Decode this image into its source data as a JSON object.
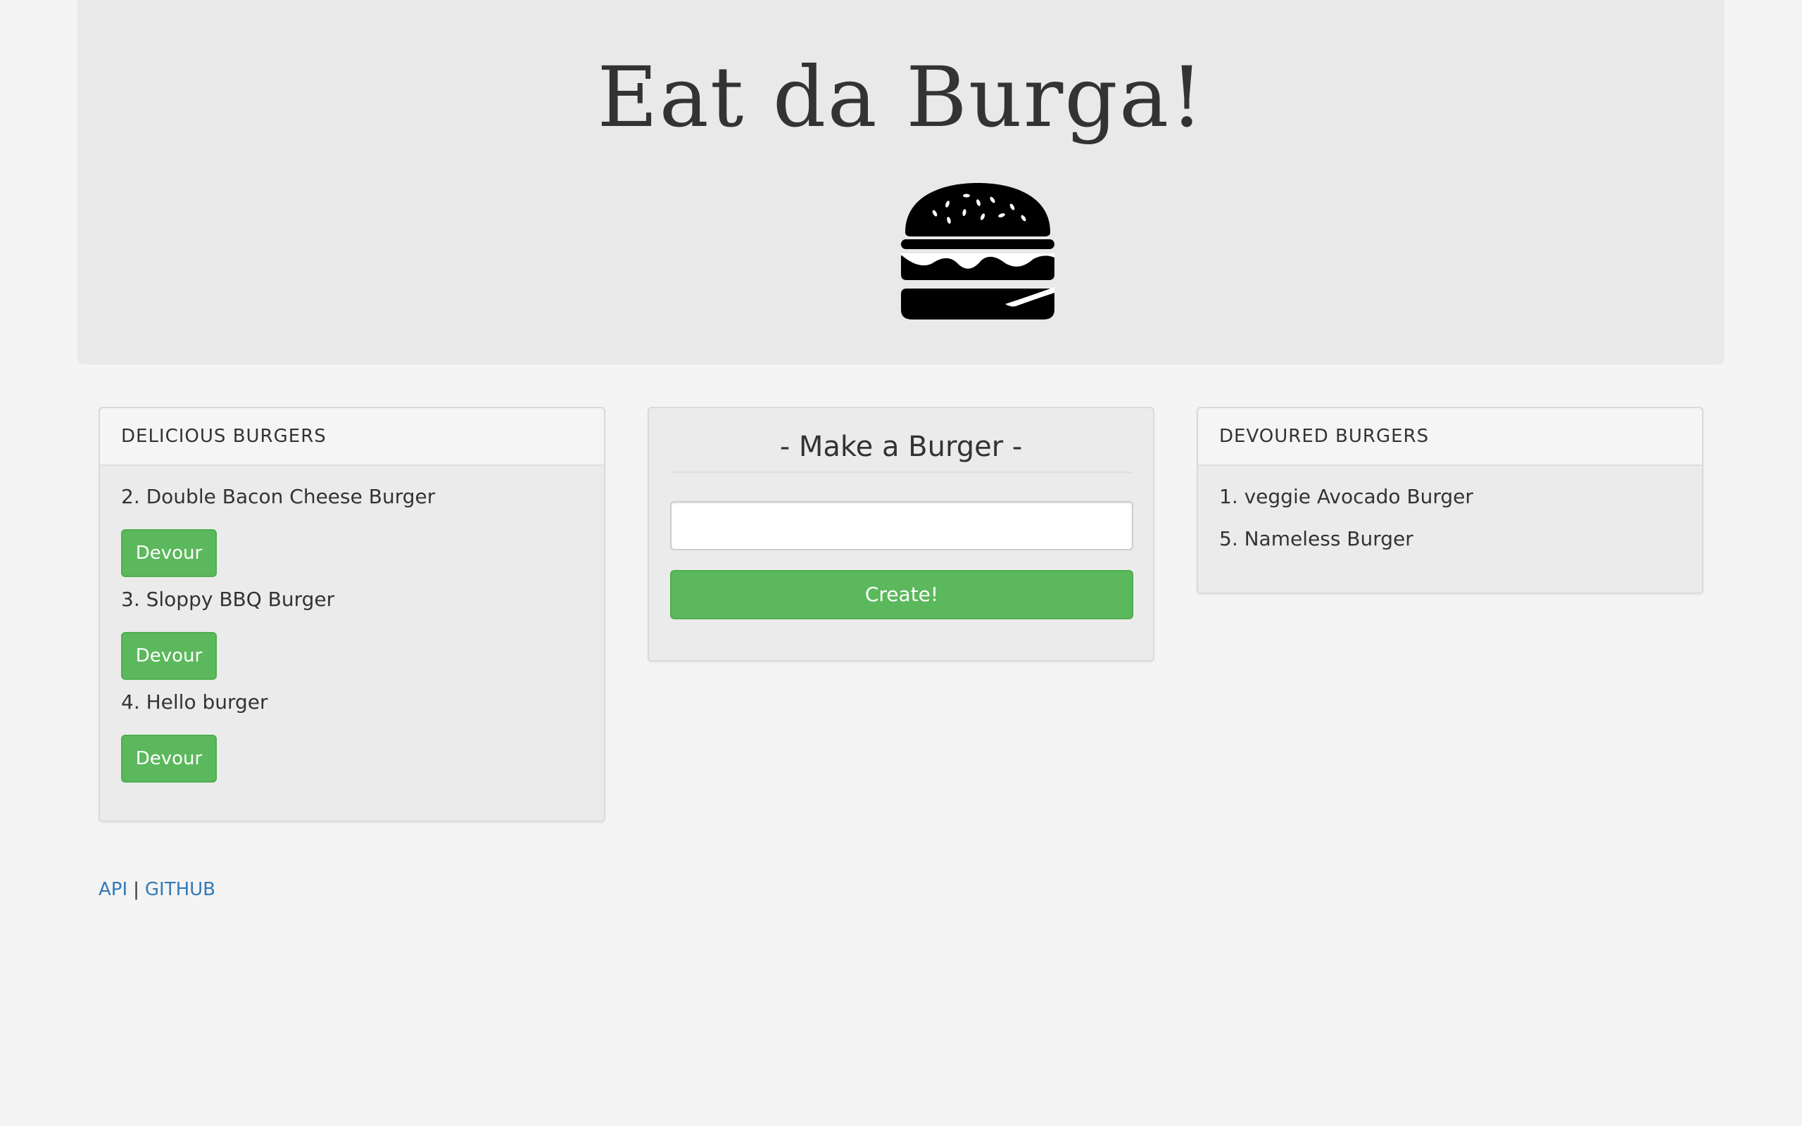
{
  "header": {
    "title": "Eat da Burga!"
  },
  "icons": {
    "hero": "hamburger-icon"
  },
  "colors": {
    "accent_green": "#5cb85c",
    "link_blue": "#337ab7",
    "jumbotron_bg": "#e9e9e9",
    "page_bg": "#f4f4f4"
  },
  "delicious": {
    "heading": "DELICIOUS BURGERS",
    "items": [
      {
        "label": "2. Double Bacon Cheese Burger",
        "button": "Devour"
      },
      {
        "label": "3. Sloppy BBQ Burger",
        "button": "Devour"
      },
      {
        "label": "4. Hello burger",
        "button": "Devour"
      }
    ]
  },
  "make": {
    "title": "- Make a Burger -",
    "input_value": "",
    "input_placeholder": "",
    "create_label": "Create!"
  },
  "devoured": {
    "heading": "DEVOURED BURGERS",
    "items": [
      {
        "label": "1. veggie Avocado Burger"
      },
      {
        "label": "5. Nameless Burger"
      }
    ]
  },
  "footer": {
    "api_label": "API",
    "separator": "|",
    "github_label": "GITHUB"
  }
}
